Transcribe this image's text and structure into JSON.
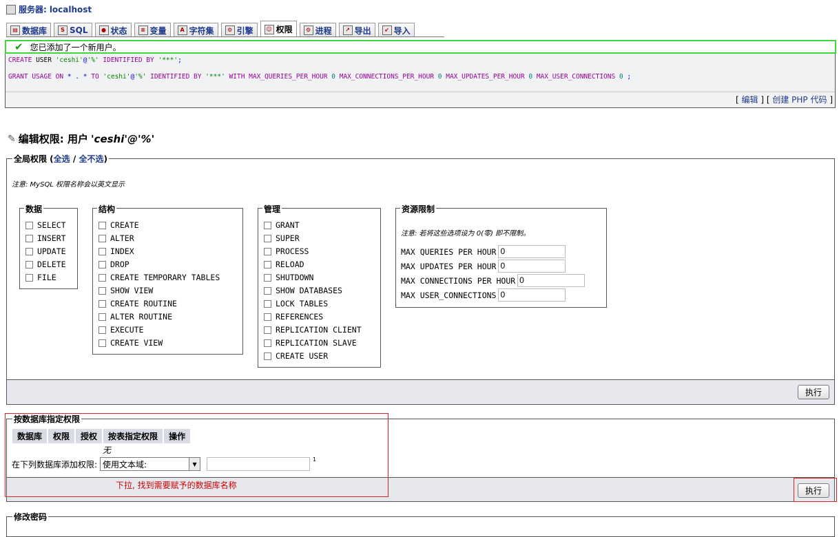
{
  "server": {
    "label": "服务器:",
    "name": "localhost"
  },
  "tabs": [
    {
      "label": "数据库",
      "icon": "database-icon"
    },
    {
      "label": "SQL",
      "icon": "sql-icon"
    },
    {
      "label": "状态",
      "icon": "status-icon"
    },
    {
      "label": "变量",
      "icon": "variables-icon"
    },
    {
      "label": "字符集",
      "icon": "charset-icon"
    },
    {
      "label": "引擎",
      "icon": "engines-icon"
    },
    {
      "label": "权限",
      "icon": "privileges-icon",
      "active": true
    },
    {
      "label": "进程",
      "icon": "processes-icon"
    },
    {
      "label": "导出",
      "icon": "export-icon"
    },
    {
      "label": "导入",
      "icon": "import-icon"
    }
  ],
  "success_message": "您已添加了一个新用户。",
  "sql": {
    "line1": {
      "kw1": "CREATE",
      "kw2": "USER",
      "user": "'ceshi'",
      "at": "@",
      "host": "'%'",
      "kw3": "IDENTIFIED BY",
      "pw": "'***'",
      "end": ";"
    },
    "line2": {
      "kw1": "GRANT USAGE ON",
      "star1": "*",
      "dot": ".",
      "star2": "*",
      "kw2": "TO",
      "user": "'ceshi'",
      "at": "@",
      "host": "'%'",
      "kw3": "IDENTIFIED BY",
      "pw": "'***'",
      "kw4": "WITH MAX_QUERIES_PER_HOUR",
      "v1": "0",
      "kw5": "MAX_CONNECTIONS_PER_HOUR",
      "v2": "0",
      "kw6": "MAX_UPDATES_PER_HOUR",
      "v3": "0",
      "kw7": "MAX_USER_CONNECTIONS",
      "v4": "0",
      "end": ";"
    },
    "footer": {
      "open": "[",
      "edit": "编辑",
      "mid": "] [",
      "php": "创建 PHP 代码",
      "close": "]"
    }
  },
  "heading": {
    "prefix": "编辑权限: 用户",
    "user": "'ceshi'@'%'"
  },
  "global": {
    "legend": "全局权限 (",
    "select_all": "全选",
    "slash": "/",
    "select_none": "全不选",
    "close": ")",
    "note": "注意: MySQL 权限名称会以英文显示",
    "data": {
      "title": "数据",
      "items": [
        "SELECT",
        "INSERT",
        "UPDATE",
        "DELETE",
        "FILE"
      ]
    },
    "structure": {
      "title": "结构",
      "items": [
        "CREATE",
        "ALTER",
        "INDEX",
        "DROP",
        "CREATE TEMPORARY TABLES",
        "SHOW VIEW",
        "CREATE ROUTINE",
        "ALTER ROUTINE",
        "EXECUTE",
        "CREATE VIEW"
      ]
    },
    "admin": {
      "title": "管理",
      "items": [
        "GRANT",
        "SUPER",
        "PROCESS",
        "RELOAD",
        "SHUTDOWN",
        "SHOW DATABASES",
        "LOCK TABLES",
        "REFERENCES",
        "REPLICATION CLIENT",
        "REPLICATION SLAVE",
        "CREATE USER"
      ]
    },
    "resources": {
      "title": "资源限制",
      "note": "注意: 若将这些选项设为 0(零) 即不限制。",
      "rows": [
        {
          "label": "MAX QUERIES PER HOUR",
          "value": "0"
        },
        {
          "label": "MAX UPDATES PER HOUR",
          "value": "0"
        },
        {
          "label": "MAX CONNECTIONS PER HOUR",
          "value": "0"
        },
        {
          "label": "MAX USER_CONNECTIONS",
          "value": "0"
        }
      ]
    },
    "go": "执行"
  },
  "db_privs": {
    "legend": "按数据库指定权限",
    "headers": [
      "数据库",
      "权限",
      "授权",
      "按表指定权限",
      "操作"
    ],
    "empty": "无",
    "add_label": "在下列数据库添加权限:",
    "select_value": "使用文本域:",
    "footnote": "1",
    "annotation": "下拉, 找到需要赋予的数据库名称",
    "go": "执行"
  },
  "change_password": {
    "legend": "修改密码"
  }
}
